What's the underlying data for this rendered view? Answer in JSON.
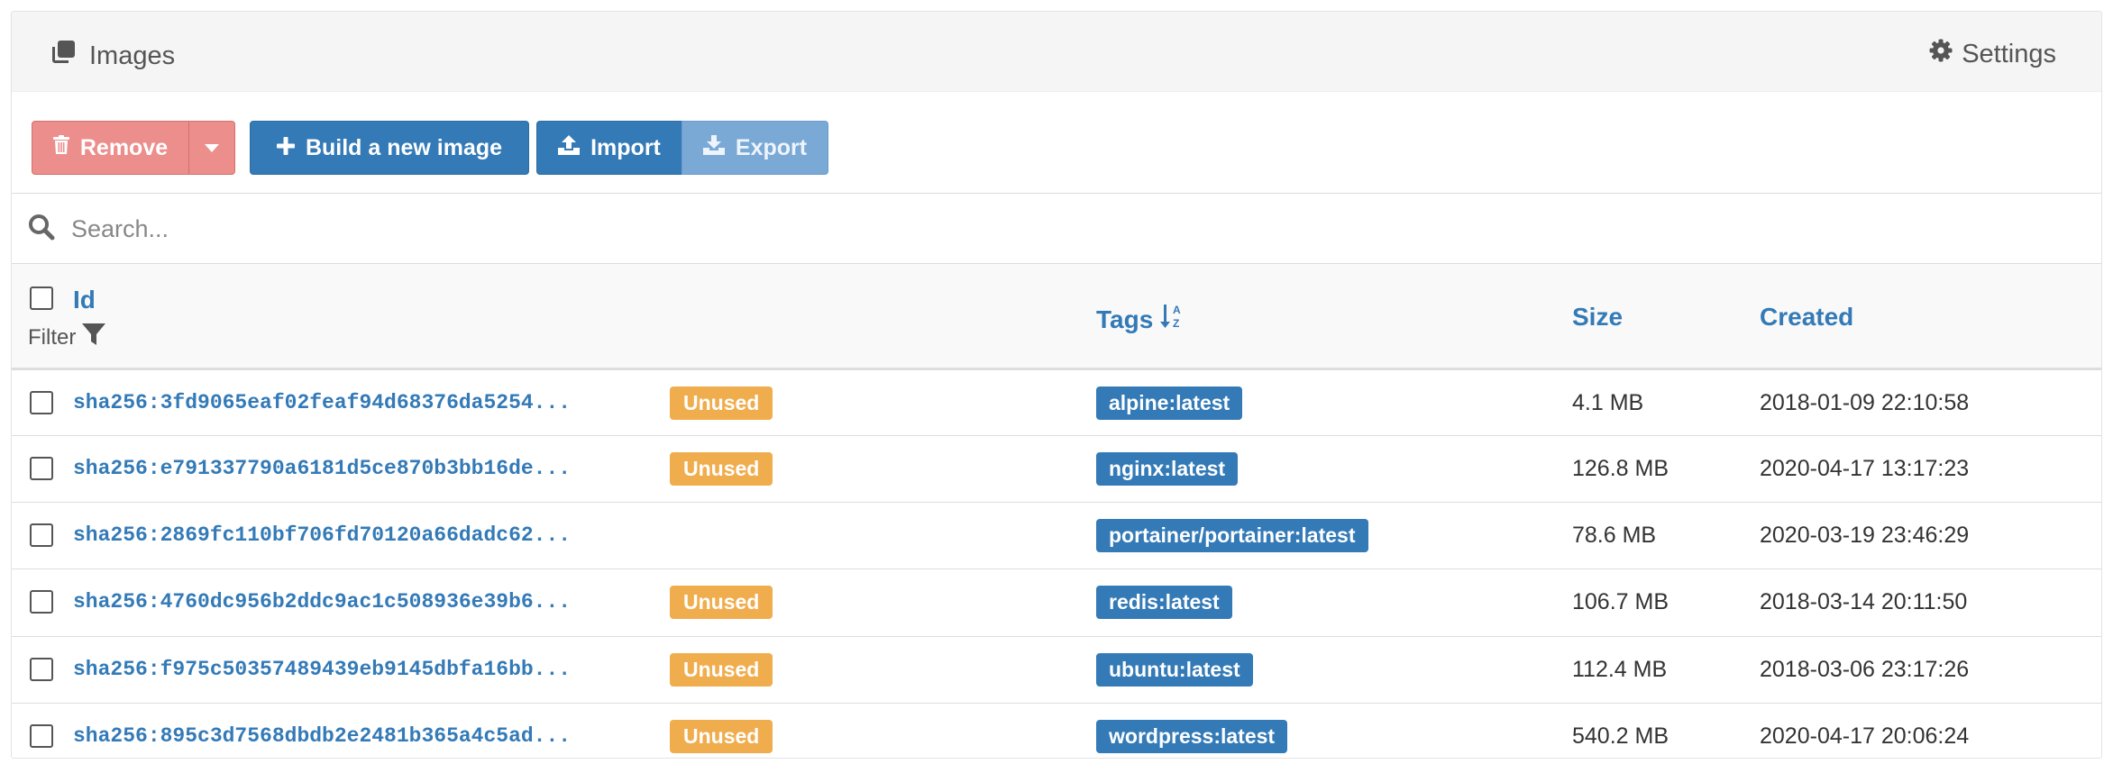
{
  "header": {
    "title": "Images",
    "settings_label": "Settings"
  },
  "toolbar": {
    "remove_label": "Remove",
    "build_label": "Build a new image",
    "import_label": "Import",
    "export_label": "Export"
  },
  "search": {
    "placeholder": "Search..."
  },
  "table": {
    "columns": {
      "id": "Id",
      "filter": "Filter",
      "tags": "Tags",
      "size": "Size",
      "created": "Created"
    },
    "rows": [
      {
        "id": "sha256:3fd9065eaf02feaf94d68376da5254...",
        "badge": "Unused",
        "tag": "alpine:latest",
        "size": "4.1 MB",
        "created": "2018-01-09 22:10:58"
      },
      {
        "id": "sha256:e791337790a6181d5ce870b3bb16de...",
        "badge": "Unused",
        "tag": "nginx:latest",
        "size": "126.8 MB",
        "created": "2020-04-17 13:17:23"
      },
      {
        "id": "sha256:2869fc110bf706fd70120a66dadc62...",
        "badge": "",
        "tag": "portainer/portainer:latest",
        "size": "78.6 MB",
        "created": "2020-03-19 23:46:29"
      },
      {
        "id": "sha256:4760dc956b2ddc9ac1c508936e39b6...",
        "badge": "Unused",
        "tag": "redis:latest",
        "size": "106.7 MB",
        "created": "2018-03-14 20:11:50"
      },
      {
        "id": "sha256:f975c50357489439eb9145dbfa16bb...",
        "badge": "Unused",
        "tag": "ubuntu:latest",
        "size": "112.4 MB",
        "created": "2018-03-06 23:17:26"
      },
      {
        "id": "sha256:895c3d7568dbdb2e2481b365a4c5ad...",
        "badge": "Unused",
        "tag": "wordpress:latest",
        "size": "540.2 MB",
        "created": "2020-04-17 20:06:24"
      }
    ]
  },
  "colors": {
    "primary": "#337ab7",
    "danger_disabled": "#eb8e8c",
    "warning": "#f0ad4e"
  }
}
